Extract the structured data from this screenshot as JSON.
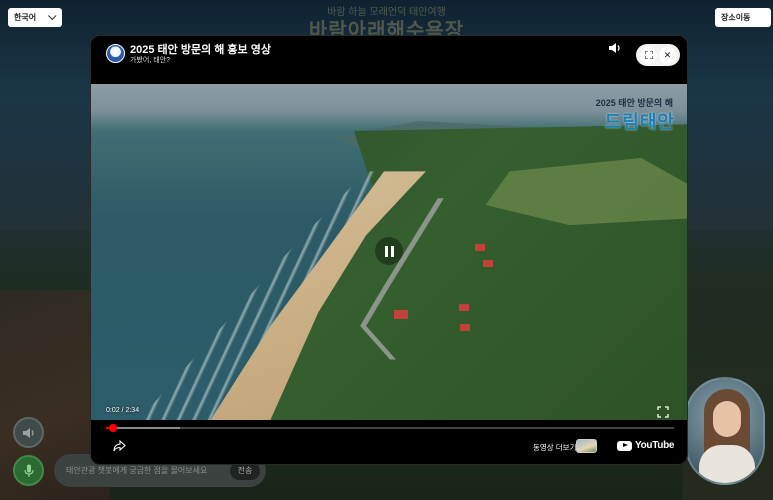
{
  "background": {
    "subtitle": "바람 하늘 모래언덕 태안여행",
    "title": "바람아래해수욕장"
  },
  "top": {
    "language_label": "한국어",
    "place_move_label": "장소이동"
  },
  "chat": {
    "placeholder": "태안관광 챗봇에게 궁금한 점을 물어보세요",
    "send_label": "전송"
  },
  "video": {
    "title": "2025 태안 방문의 해 홍보 영상",
    "channel": "가봤어, 태안?",
    "overlay_small": "2025 태안 방문의 해",
    "overlay_big": "드림태안",
    "current_time": "0:02",
    "duration": "2:34",
    "time_display": "0:02 / 2:34",
    "progress_fraction": 0.013,
    "buffered_fraction": 0.13,
    "more_videos_label": "동영상 더보기",
    "youtube_label": "YouTube",
    "header_button_glyphs": {
      "close": "✕"
    }
  },
  "colors": {
    "progress": "#ff0000",
    "modal_bg": "#000000",
    "mic_button": "#2b6a33"
  }
}
